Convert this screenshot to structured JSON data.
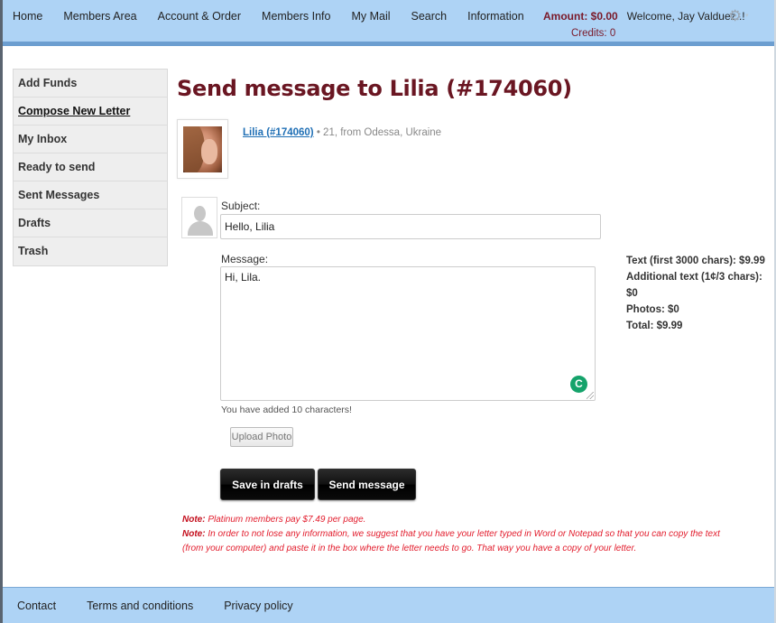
{
  "nav": {
    "items": [
      "Home",
      "Members Area",
      "Account & Order",
      "Members Info",
      "My Mail",
      "Search",
      "Information"
    ]
  },
  "account": {
    "amount": "Amount: $0.00",
    "welcome": "Welcome, Jay Valduez..!",
    "credits": "Credits: 0",
    "gear_icon": "⚙",
    "caret": "▾"
  },
  "sidebar": {
    "items": [
      {
        "label": "Add Funds"
      },
      {
        "label": "Compose New Letter",
        "active": true
      },
      {
        "label": "My Inbox"
      },
      {
        "label": "Ready to send"
      },
      {
        "label": "Sent Messages"
      },
      {
        "label": "Drafts"
      },
      {
        "label": "Trash"
      }
    ]
  },
  "main": {
    "title": "Send message to Lilia (#174060)",
    "recipient": {
      "link": "Lilia (#174060)",
      "details": " • 21, from Odessa, Ukraine"
    },
    "form": {
      "subject_label": "Subject:",
      "subject_value": "Hello, Lilia",
      "message_label": "Message:",
      "message_value": "Hi, Lila.",
      "grammarly_icon": "C",
      "char_count": "You have added 10 characters!",
      "upload_label": "Upload Photo",
      "save_label": "Save in drafts",
      "send_label": "Send message"
    },
    "pricing": {
      "text": "Text (first 3000 chars): $9.99",
      "additional": "Additional text (1¢/3 chars): $0",
      "photos": "Photos: $0",
      "total": "Total: $9.99"
    },
    "notes": [
      {
        "label": "Note:",
        "text": " Platinum members pay $7.49 per page."
      },
      {
        "label": "Note:",
        "text": " In order to not lose any information, we suggest that you have your letter typed in Word or Notepad so that you can copy the text (from your computer) and paste it in the box where the letter needs to go. That way you have a copy of your letter."
      }
    ]
  },
  "footer": {
    "links": [
      "Contact",
      "Terms and conditions",
      "Privacy policy"
    ]
  }
}
